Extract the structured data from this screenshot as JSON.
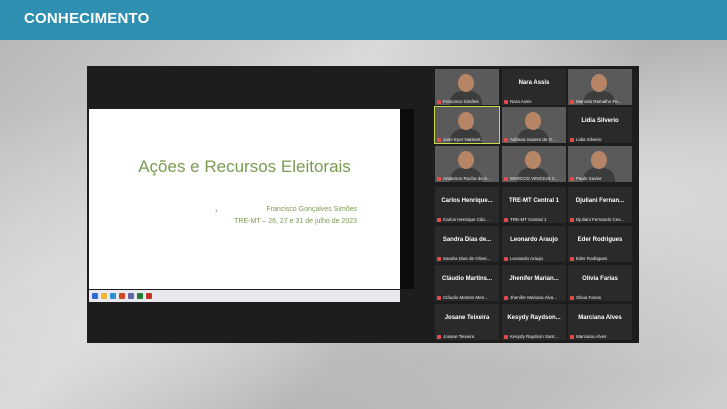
{
  "banner": {
    "title": "CONHECIMENTO"
  },
  "slide": {
    "title": "Ações e Recursos Eleitorais",
    "bullet": "›",
    "author": "Francisco Gonçalves Simões",
    "date": "TRE-MT – 26, 27 e 31 de julho de 2023"
  },
  "participants": [
    {
      "name": "Francisco Simões",
      "tile_name": "",
      "video": true
    },
    {
      "name": "Nara Assis",
      "tile_name": "Nara Assis",
      "video": false
    },
    {
      "name": "Marcela Ramalho Fe...",
      "tile_name": "",
      "video": true
    },
    {
      "name": "Jane Eyer Natanet...",
      "tile_name": "",
      "video": true
    },
    {
      "name": "Adriana Soares de O...",
      "tile_name": "",
      "video": true
    },
    {
      "name": "Lidia Silverio",
      "tile_name": "Lidia Silverio",
      "video": false
    },
    {
      "name": "Anderson Rocha de S...",
      "tile_name": "",
      "video": true
    },
    {
      "name": "MARCOS VINICIUS C...",
      "tile_name": "",
      "video": true
    },
    {
      "name": "Paulo Xavier",
      "tile_name": "",
      "video": true
    },
    {
      "name": "Carlos Henrique Cân...",
      "tile_name": "Carlos Henrique...",
      "video": false
    },
    {
      "name": "TRE-MT Central 1",
      "tile_name": "TRE-MT Central 1",
      "video": false
    },
    {
      "name": "Djuliani Fernando Ces...",
      "tile_name": "Djuliani Fernan...",
      "video": false
    },
    {
      "name": "Sandra Dias de Olivei...",
      "tile_name": "Sandra Dias de...",
      "video": false
    },
    {
      "name": "Leonardo Araujo",
      "tile_name": "Leonardo Araujo",
      "video": false
    },
    {
      "name": "Eder Rodrigues",
      "tile_name": "Eder Rodrigues",
      "video": false
    },
    {
      "name": "Cláudio Martins Men...",
      "tile_name": "Cláudio Martins...",
      "video": false
    },
    {
      "name": "Jhenifer Mariana Alva...",
      "tile_name": "Jhenifer Marian...",
      "video": false
    },
    {
      "name": "Olivia Farias",
      "tile_name": "Olivia Farias",
      "video": false
    },
    {
      "name": "Josane Teixeira",
      "tile_name": "Josane Teixeira",
      "video": false
    },
    {
      "name": "Kesydy Raydson Sant...",
      "tile_name": "Kesydy Raydson...",
      "video": false
    },
    {
      "name": "Marciana Alves",
      "tile_name": "Marciana Alves",
      "video": false
    }
  ]
}
